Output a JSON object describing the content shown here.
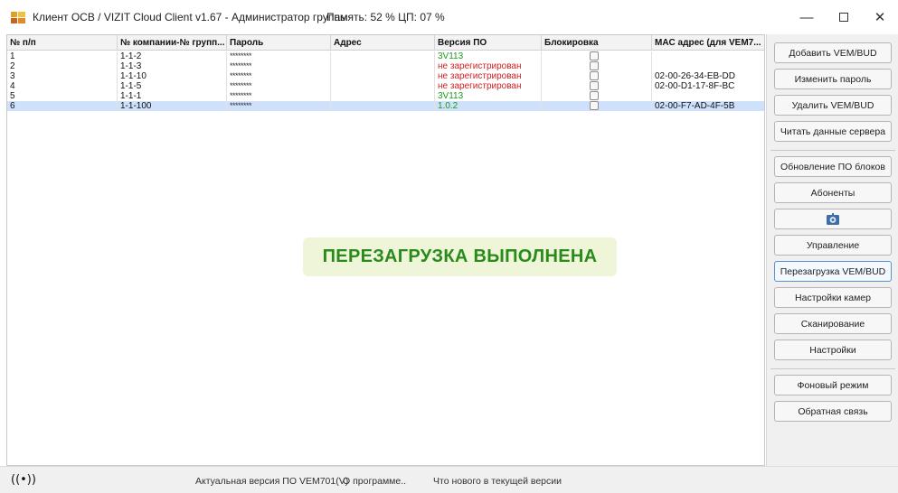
{
  "window": {
    "title": "Клиент ОСВ / VIZIT Cloud Client v1.67 - Администратор группы",
    "memory": "Память: 52 %  ЦП: 07 %",
    "controls": {
      "minimize": "—",
      "maximize": "",
      "close": "✕"
    }
  },
  "table": {
    "columns": [
      "№ п/п",
      "№ компании-№ групп...",
      "Пароль",
      "Адрес",
      "Версия ПО",
      "Блокировка",
      "MAC адрес (для VEM7..."
    ],
    "rows": [
      {
        "n": "1",
        "company": "1-1-2",
        "password": "********",
        "address": "",
        "version": "3V113",
        "version_status": "ok",
        "blocked": false,
        "mac": ""
      },
      {
        "n": "2",
        "company": "1-1-3",
        "password": "********",
        "address": "",
        "version": "не зарегистрирован",
        "version_status": "bad",
        "blocked": false,
        "mac": ""
      },
      {
        "n": "3",
        "company": "1-1-10",
        "password": "********",
        "address": "",
        "version": "не зарегистрирован",
        "version_status": "bad",
        "blocked": false,
        "mac": "02-00-26-34-EB-DD"
      },
      {
        "n": "4",
        "company": "1-1-5",
        "password": "********",
        "address": "",
        "version": "не зарегистрирован",
        "version_status": "bad",
        "blocked": false,
        "mac": "02-00-D1-17-8F-BC"
      },
      {
        "n": "5",
        "company": "1-1-1",
        "password": "********",
        "address": "",
        "version": "3V113",
        "version_status": "ok",
        "blocked": false,
        "mac": ""
      },
      {
        "n": "6",
        "company": "1-1-100",
        "password": "********",
        "address": "",
        "version": "1.0.2",
        "version_status": "ok",
        "blocked": false,
        "mac": "02-00-F7-AD-4F-5B",
        "selected": true
      }
    ]
  },
  "toast": {
    "message": "ПЕРЕЗАГРУЗКА ВЫПОЛНЕНА"
  },
  "panel": {
    "add": "Добавить VEM/BUD",
    "change_password": "Изменить пароль",
    "delete": "Удалить VEM/BUD",
    "read_server": "Читать данные сервера",
    "update_fw": "Обновление ПО блоков",
    "subscribers": "Абоненты",
    "settings_icon": "gear-icon",
    "control": "Управление",
    "reboot": "Перезагрузка VEM/BUD",
    "camera_settings": "Настройки камер",
    "scanning": "Сканирование",
    "settings": "Настройки",
    "background": "Фоновый режим",
    "feedback": "Обратная связь"
  },
  "status": {
    "radio_icon": "((•))",
    "current_version": "Актуальная версия ПО VEM701(V)",
    "about": "О программе..",
    "whats_new": "Что нового в текущей версии"
  },
  "colors": {
    "ok_version": "#1b9a1b",
    "bad_version": "#d22020",
    "selected_row": "#cfe0fb",
    "toast_text": "#2a8a1a",
    "toast_bg": "#eef5d9"
  }
}
